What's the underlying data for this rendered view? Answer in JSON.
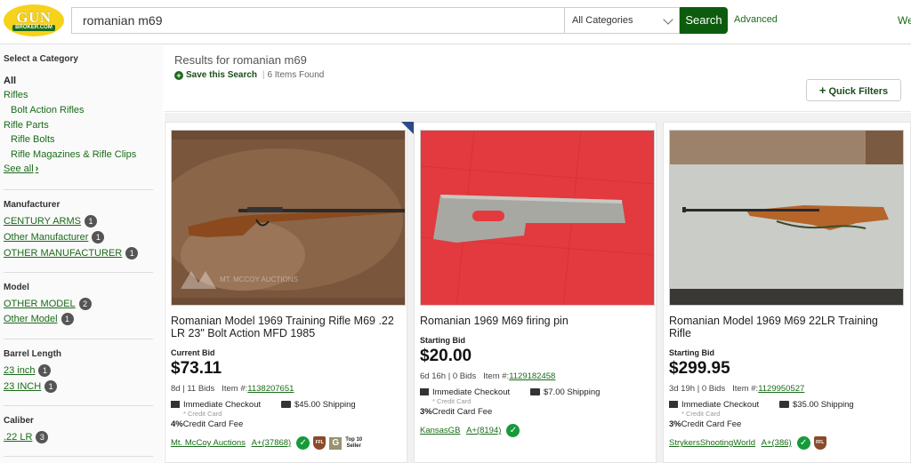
{
  "header": {
    "logo_top": "GUN",
    "logo_bottom": "BROKER.COM",
    "search_value": "romanian m69",
    "category": "All Categories",
    "search_button": "Search",
    "advanced": "Advanced",
    "welcome": "We"
  },
  "sidebar": {
    "select_category": "Select a Category",
    "all": "All",
    "categories": [
      "Rifles",
      "Bolt Action Rifles",
      "Rifle Parts",
      "Rifle Bolts",
      "Rifle Magazines & Rifle Clips"
    ],
    "see_all": "See all",
    "sections": [
      {
        "title": "Manufacturer",
        "items": [
          {
            "label": "CENTURY ARMS",
            "count": "1"
          },
          {
            "label": "Other Manufacturer",
            "count": "1"
          },
          {
            "label": "OTHER MANUFACTURER",
            "count": "1"
          }
        ]
      },
      {
        "title": "Model",
        "items": [
          {
            "label": "OTHER MODEL",
            "count": "2"
          },
          {
            "label": "Other Model",
            "count": "1"
          }
        ]
      },
      {
        "title": "Barrel Length",
        "items": [
          {
            "label": "23 inch",
            "count": "1"
          },
          {
            "label": "23 INCH",
            "count": "1"
          }
        ]
      },
      {
        "title": "Caliber",
        "items": [
          {
            "label": ".22 LR",
            "count": "3"
          }
        ]
      }
    ]
  },
  "results": {
    "title": "Results for romanian m69",
    "save": "Save this Search",
    "found": "6 Items Found",
    "quick_filters": "Quick Filters"
  },
  "listings": [
    {
      "title": "Romanian Model 1969 Training Rifle M69 .22 LR 23\" Bolt Action MFD 1985",
      "bid_label": "Current Bid",
      "price": "$73.11",
      "time": "8d",
      "bids": "11 Bids",
      "item_label": "Item #:",
      "item": "1138207651",
      "checkout": "Immediate Checkout",
      "credit": "* Credit Card",
      "shipping": "$45.00 Shipping",
      "fee_pct": "4%",
      "fee": "Credit Card Fee",
      "seller": "Mt. McCoy Auctions",
      "rating": "A+(37868)",
      "watermark": "MT. MCCOY AUCTIONS",
      "top10": [
        "Top 10",
        "Seller"
      ],
      "ffl": "FFL",
      "g": "G"
    },
    {
      "title": "Romanian 1969 M69 firing pin",
      "bid_label": "Starting Bid",
      "price": "$20.00",
      "time": "6d 16h",
      "bids": "0 Bids",
      "item_label": "Item #:",
      "item": "1129182458",
      "checkout": "Immediate Checkout",
      "credit": "* Credit Card",
      "shipping": "$7.00 Shipping",
      "fee_pct": "3%",
      "fee": "Credit Card Fee",
      "seller": "KansasGB",
      "rating": "A+(8194)"
    },
    {
      "title": "Romanian Model 1969 M69 22LR Training Rifle",
      "bid_label": "Starting Bid",
      "price": "$299.95",
      "time": "3d 19h",
      "bids": "0 Bids",
      "item_label": "Item #:",
      "item": "1129950527",
      "checkout": "Immediate Checkout",
      "credit": "* Credit Card",
      "shipping": "$35.00 Shipping",
      "fee_pct": "3%",
      "fee": "Credit Card Fee",
      "seller": "StrykersShootingWorld",
      "rating": "A+(386)",
      "ffl": "FFL"
    }
  ],
  "colors": {
    "accent": "#1a6b1a",
    "search_button": "#0d5c0d",
    "logo": "#f7d21a",
    "badge": "#555555"
  },
  "icons": [
    "plus-circle-icon",
    "chevron-down-icon",
    "chevron-right-icon",
    "card-icon",
    "truck-icon",
    "check-badge-icon",
    "ffl-badge-icon",
    "featured-corner-icon"
  ]
}
